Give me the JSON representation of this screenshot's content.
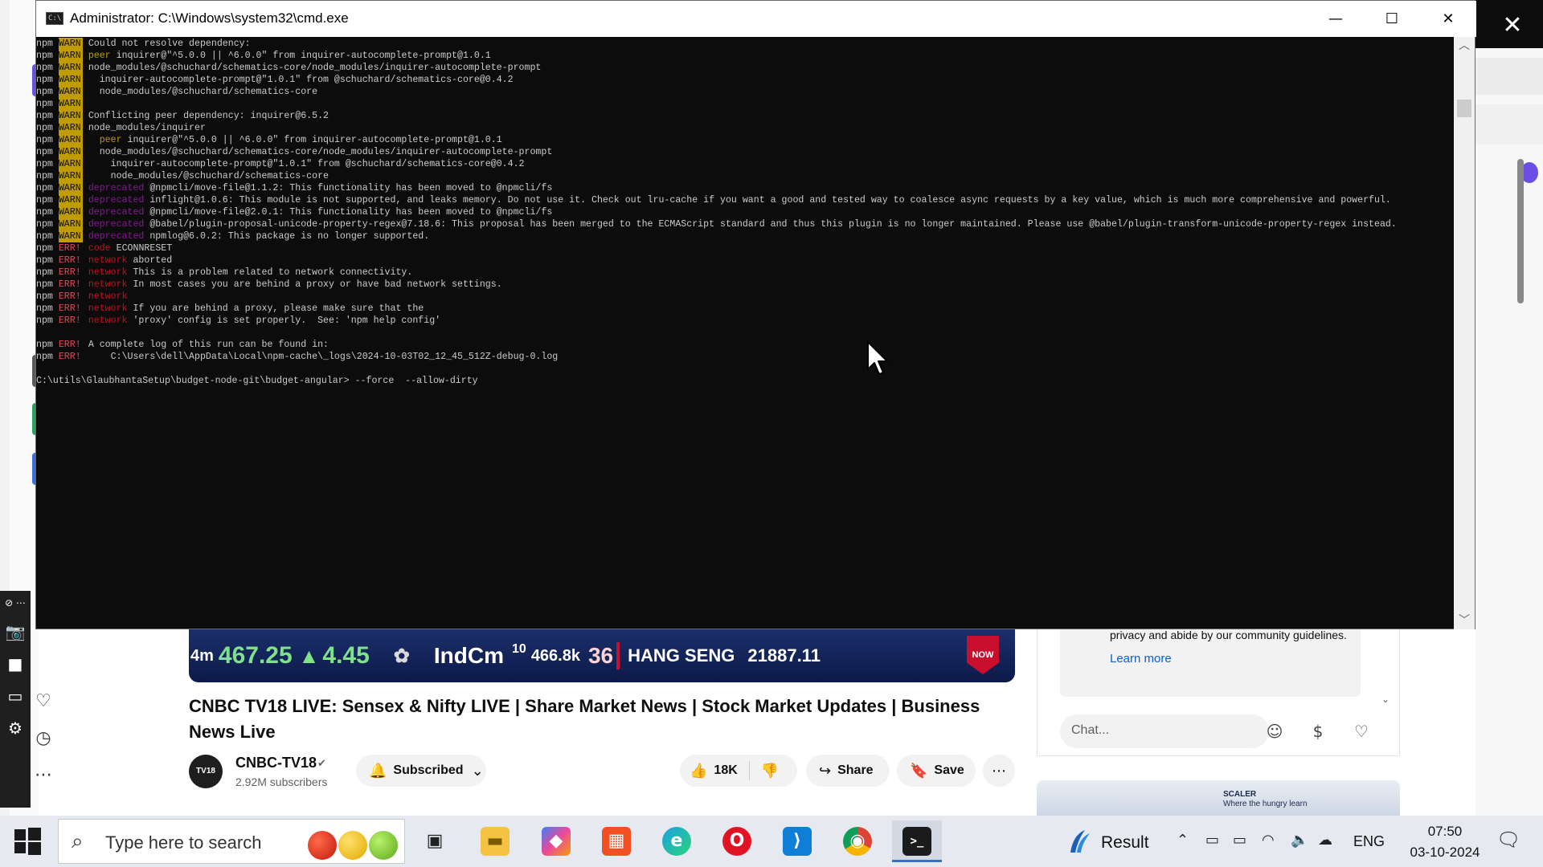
{
  "cmd": {
    "title": "Administrator:  C:\\Windows\\system32\\cmd.exe",
    "lines": [
      {
        "pre": "npm ",
        "level": "WARN",
        "kw": "",
        "text": "Could not resolve dependency:"
      },
      {
        "pre": "npm ",
        "level": "WARN",
        "kw": "peer",
        "text": " inquirer@\"^5.0.0 || ^6.0.0\" from inquirer-autocomplete-prompt@1.0.1"
      },
      {
        "pre": "npm ",
        "level": "WARN",
        "kw": "",
        "text": "node_modules/@schuchard/schematics-core/node_modules/inquirer-autocomplete-prompt"
      },
      {
        "pre": "npm ",
        "level": "WARN",
        "kw": "",
        "text": "  inquirer-autocomplete-prompt@\"1.0.1\" from @schuchard/schematics-core@0.4.2"
      },
      {
        "pre": "npm ",
        "level": "WARN",
        "kw": "",
        "text": "  node_modules/@schuchard/schematics-core"
      },
      {
        "pre": "npm ",
        "level": "WARN",
        "kw": "",
        "text": ""
      },
      {
        "pre": "npm ",
        "level": "WARN",
        "kw": "",
        "text": "Conflicting peer dependency: inquirer@6.5.2"
      },
      {
        "pre": "npm ",
        "level": "WARN",
        "kw": "",
        "text": "node_modules/inquirer"
      },
      {
        "pre": "npm ",
        "level": "WARN",
        "kw": "  peer",
        "text": " inquirer@\"^5.0.0 || ^6.0.0\" from inquirer-autocomplete-prompt@1.0.1"
      },
      {
        "pre": "npm ",
        "level": "WARN",
        "kw": "",
        "text": "  node_modules/@schuchard/schematics-core/node_modules/inquirer-autocomplete-prompt"
      },
      {
        "pre": "npm ",
        "level": "WARN",
        "kw": "",
        "text": "    inquirer-autocomplete-prompt@\"1.0.1\" from @schuchard/schematics-core@0.4.2"
      },
      {
        "pre": "npm ",
        "level": "WARN",
        "kw": "",
        "text": "    node_modules/@schuchard/schematics-core"
      },
      {
        "pre": "npm ",
        "level": "WARN",
        "kw": "deprecated",
        "text": " @npmcli/move-file@1.1.2: This functionality has been moved to @npmcli/fs"
      },
      {
        "pre": "npm ",
        "level": "WARN",
        "kw": "deprecated",
        "text": " inflight@1.0.6: This module is not supported, and leaks memory. Do not use it. Check out lru-cache if you want a good and tested way to coalesce async requests by a key value, which is much more comprehensive and powerful."
      },
      {
        "pre": "npm ",
        "level": "WARN",
        "kw": "deprecated",
        "text": " @npmcli/move-file@2.0.1: This functionality has been moved to @npmcli/fs"
      },
      {
        "pre": "npm ",
        "level": "WARN",
        "kw": "deprecated",
        "text": " @babel/plugin-proposal-unicode-property-regex@7.18.6: This proposal has been merged to the ECMAScript standard and thus this plugin is no longer maintained. Please use @babel/plugin-transform-unicode-property-regex instead."
      },
      {
        "pre": "npm ",
        "level": "WARN",
        "kw": "deprecated",
        "text": " npmlog@6.0.2: This package is no longer supported."
      },
      {
        "pre": "npm ",
        "level": "ERR!",
        "kw": "code",
        "text": " ECONNRESET"
      },
      {
        "pre": "npm ",
        "level": "ERR!",
        "kw": "network",
        "text": " aborted"
      },
      {
        "pre": "npm ",
        "level": "ERR!",
        "kw": "network",
        "text": " This is a problem related to network connectivity."
      },
      {
        "pre": "npm ",
        "level": "ERR!",
        "kw": "network",
        "text": " In most cases you are behind a proxy or have bad network settings."
      },
      {
        "pre": "npm ",
        "level": "ERR!",
        "kw": "network",
        "text": ""
      },
      {
        "pre": "npm ",
        "level": "ERR!",
        "kw": "network",
        "text": " If you are behind a proxy, please make sure that the"
      },
      {
        "pre": "npm ",
        "level": "ERR!",
        "kw": "network",
        "text": " 'proxy' config is set properly.  See: 'npm help config'"
      },
      {
        "pre": "",
        "level": "",
        "kw": "",
        "text": ""
      },
      {
        "pre": "npm ",
        "level": "ERR!",
        "kw": "",
        "text": "A complete log of this run can be found in:"
      },
      {
        "pre": "npm ",
        "level": "ERR!",
        "kw": "",
        "text": "    C:\\Users\\dell\\AppData\\Local\\npm-cache\\_logs\\2024-10-03T02_12_45_512Z-debug-0.log"
      },
      {
        "pre": "",
        "level": "",
        "kw": "",
        "text": ""
      },
      {
        "pre": "",
        "level": "",
        "kw": "",
        "text": "C:\\utils\\GlaubhantaSetup\\budget-node-git\\budget-angular> --force  --allow-dirty"
      }
    ]
  },
  "youtube": {
    "ticker": {
      "prefix": "4m",
      "price": "467.25",
      "change": "4.45",
      "index_name": "IndCm",
      "index_time": "10",
      "index_value": "466.8k",
      "index_pct": "36",
      "hang_seng_label": "HANG SENG",
      "hang_seng_value": "21887.11",
      "now_badge": "NOW"
    },
    "video_title": "CNBC TV18 LIVE: Sensex & Nifty LIVE | Share Market News | Stock Market Updates | Business News Live",
    "channel": {
      "avatar_text": "TV18",
      "name": "CNBC-TV18",
      "verified_icon": "verified-check-icon",
      "subscribers": "2.92M subscribers",
      "subscribed_label": "Subscribed"
    },
    "actions": {
      "likes": "18K",
      "share_label": "Share",
      "save_label": "Save"
    },
    "chat": {
      "welcome": "Welcome to live chat! Remember to guard your privacy and abide by our community guidelines.",
      "learn_more": "Learn more",
      "input_placeholder": "Chat..."
    },
    "ad": {
      "brand": "SCALER",
      "tagline": "Where the hungry learn"
    }
  },
  "taskbar": {
    "search_placeholder": "Type here to search",
    "result_label": "Result",
    "language": "ENG",
    "time": "07:50",
    "date": "03-10-2024",
    "apps": [
      {
        "name": "task-view",
        "glyph": "▣"
      },
      {
        "name": "file-explorer",
        "glyph": "▬"
      },
      {
        "name": "copilot",
        "glyph": "◆"
      },
      {
        "name": "microsoft-store",
        "glyph": "▦"
      },
      {
        "name": "edge",
        "glyph": "e"
      },
      {
        "name": "opera",
        "glyph": "O"
      },
      {
        "name": "vscode",
        "glyph": "⟩"
      },
      {
        "name": "chrome",
        "glyph": "◉"
      },
      {
        "name": "terminal",
        "glyph": ">_"
      }
    ]
  },
  "colors": {
    "cmd_bg": "#0c0c0c",
    "warn_bg": "#c19c00",
    "err": "#e74856",
    "dep": "#881798",
    "taskbar_bg": "#e6eaf0"
  }
}
